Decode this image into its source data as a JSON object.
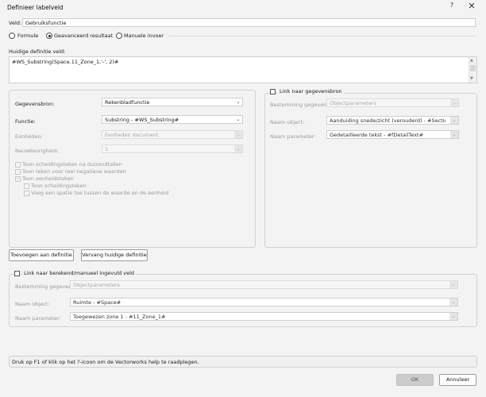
{
  "window": {
    "title": "Definieer labelveld",
    "help_glyph": "?",
    "close_glyph": "✕"
  },
  "field": {
    "label": "Veld:",
    "value": "Gebruiksfunctie"
  },
  "mode_options": [
    {
      "label": "Formule",
      "selected": false
    },
    {
      "label": "Geavanceerd resultaat",
      "selected": true
    },
    {
      "label": "Manuele invoer",
      "selected": false
    }
  ],
  "definition": {
    "label": "Huidige definitie veld:",
    "value": "#WS_Substring(Space.11_Zone_1,'-', 2)#"
  },
  "left_panel": {
    "data_source_label": "Gegevensbron:",
    "data_source_value": "Rekenbladfunctie",
    "function_label": "Functie:",
    "function_value": "Substring - #WS_Substring#",
    "units_label": "Eenheden:",
    "units_value": "Eenheden document",
    "precision_label": "Nauwkeurigheid:",
    "precision_value": "1",
    "options": [
      {
        "label": "Toon scheidingsteken na duizendtallen",
        "checked": false,
        "indent": 0
      },
      {
        "label": "Toon teken voor reel negatieve waarden",
        "checked": false,
        "indent": 0
      },
      {
        "label": "Toon eenheidsteken",
        "checked": true,
        "indent": 0
      },
      {
        "label": "Toon scheidingsteken",
        "checked": false,
        "indent": 1
      },
      {
        "label": "Voeg een spatie toe tussen de waarde en de eenheid",
        "checked": false,
        "indent": 1
      }
    ]
  },
  "right_panel": {
    "link_label": "Link naar gegevensbron",
    "destination_label": "Bestemming gegevens:",
    "destination_value": "Objectparameters",
    "object_label": "Naam object:",
    "object_value": "Aanduiding snede/zicht (verouderd) - #Section-Ele...",
    "param_label": "Naam parameter:",
    "param_value": "Gedetailleerde tekst - #fDetailText#"
  },
  "buttons": {
    "add": "Toevoegen aan definitie",
    "replace": "Vervang huidige definitie",
    "ok": "OK",
    "cancel": "Annuleer"
  },
  "bottom_panel": {
    "link_label": "Link naar berekend/manueel ingevuld veld",
    "destination_label": "Bestemming gegevens:",
    "destination_value": "Objectparameters",
    "object_label": "Naam object:",
    "object_value": "Ruimte - #Space#",
    "param_label": "Naam parameter:",
    "param_value": "Toegewezen zone 1 - #11_Zone_1#"
  },
  "help_text": "Druk op F1 of klik op het ?-icoon om de Vectorworks help te raadplegen.",
  "icons": {
    "chevron_down": "⌄",
    "check": "✓",
    "scroll_up": "▲",
    "scroll_down": "▼"
  }
}
